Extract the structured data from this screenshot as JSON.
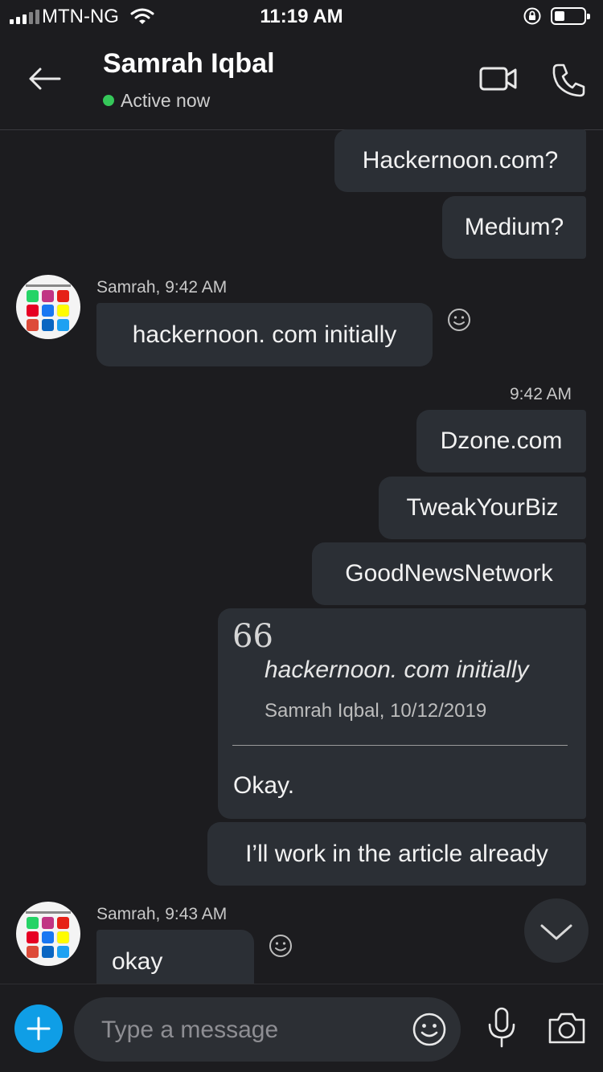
{
  "status_bar": {
    "carrier": "MTN-NG",
    "time": "11:19 AM",
    "icons": [
      "signal-icon",
      "wifi-icon",
      "rotation-lock-icon",
      "battery-icon"
    ]
  },
  "header": {
    "contact_name": "Samrah Iqbal",
    "presence": "Active now",
    "presence_color": "#35c759",
    "icons": [
      "back-arrow-icon",
      "video-call-icon",
      "phone-icon"
    ]
  },
  "messages": {
    "m1": "Hackernoon.com?",
    "m2": "Medium?",
    "in1_meta": "Samrah, 9:42 AM",
    "in1_text": "hackernoon. com initially",
    "out_time": "9:42 AM",
    "m3": "Dzone.com",
    "m4": "TweakYourBiz",
    "m5": "GoodNewsNetwork",
    "quote": {
      "mark": "66",
      "text": "hackernoon. com initially",
      "source": "Samrah Iqbal, 10/12/2019",
      "reply": "Okay."
    },
    "m6": "I’ll work in the article already",
    "in2_meta": "Samrah, 9:43 AM",
    "in2_text": "okay"
  },
  "compose": {
    "placeholder": "Type a message",
    "accent": "#0f9ee6",
    "icons": [
      "plus-icon",
      "emoji-icon",
      "microphone-icon",
      "camera-icon"
    ]
  }
}
